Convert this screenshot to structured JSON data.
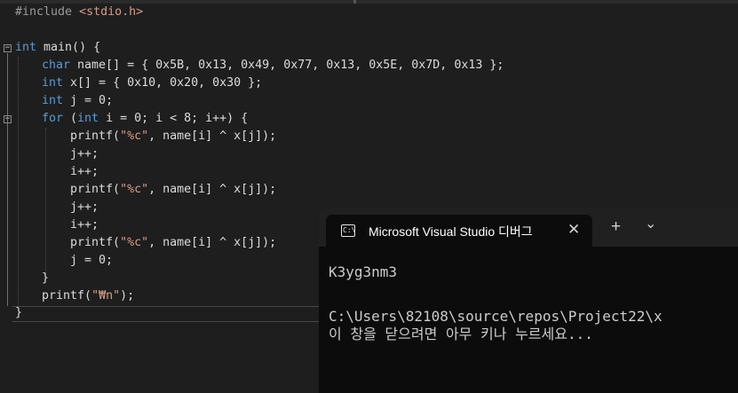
{
  "editor": {
    "lines": {
      "l1": {
        "directive": "#include",
        "header": "<stdio.h>"
      },
      "l3": {
        "type": "int",
        "rest": " main() {"
      },
      "l4": {
        "type": "char",
        "rest": " name[] = { 0x5B, 0x13, 0x49, 0x77, 0x13, 0x5E, 0x7D, 0x13 };"
      },
      "l5": {
        "type": "int",
        "rest": " x[] = { 0x10, 0x20, 0x30 };"
      },
      "l6": {
        "type": "int",
        "rest": " j = 0;"
      },
      "l7": {
        "kw1": "for",
        "p1": " (",
        "kw2": "int",
        "rest": " i = 0; i < 8; i++) {"
      },
      "l8": {
        "fn": "printf",
        "open": "(",
        "str": "\"%c\"",
        "rest": ", name[i] ^ x[j]);"
      },
      "l9": {
        "text": "j++;"
      },
      "l10": {
        "text": "i++;"
      },
      "l11": {
        "fn": "printf",
        "open": "(",
        "str": "\"%c\"",
        "rest": ", name[i] ^ x[j]);"
      },
      "l12": {
        "text": "j++;"
      },
      "l13": {
        "text": "i++;"
      },
      "l14": {
        "fn": "printf",
        "open": "(",
        "str": "\"%c\"",
        "rest": ", name[i] ^ x[j]);"
      },
      "l15": {
        "text": "j = 0;"
      },
      "l16": {
        "text": "}"
      },
      "l17": {
        "fn": "printf",
        "open": "(",
        "str": "\"₩n\"",
        "rest": ");"
      },
      "l18": {
        "text": "}"
      }
    }
  },
  "terminal": {
    "tab_title": "Microsoft Visual Studio 디버그",
    "tab_icon_glyph": "C:\\",
    "close_glyph": "✕",
    "new_tab_glyph": "+",
    "dropdown_glyph": "⌄",
    "output": "K3yg3nm3",
    "path_line": "C:\\Users\\82108\\source\\repos\\Project22\\x",
    "prompt_line": "이 창을 닫으려면 아무 키나 누르세요..."
  },
  "colors": {
    "editor_bg": "#1e1e1e",
    "keyword": "#569cd6",
    "string": "#d69d85",
    "terminal_bg": "#0c0c0c"
  }
}
